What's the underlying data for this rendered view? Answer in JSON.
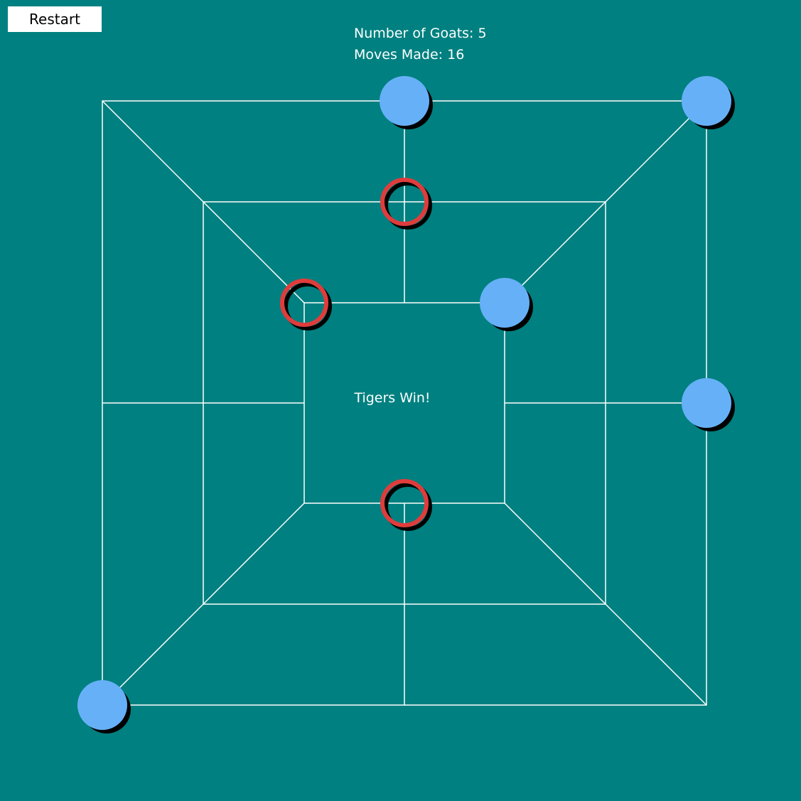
{
  "app": {
    "restart_label": "Restart",
    "goats_text": "Number of Goats: 5",
    "moves_text": "Moves Made: 16",
    "result_text": "Tigers Win!"
  },
  "colors": {
    "background": "#008080",
    "board_lines": "#ffffff",
    "goat": "#66b0f8",
    "tiger": "#e03c3c",
    "shadow": "#000000"
  },
  "board": {
    "rings": 3,
    "goats": [
      {
        "ring": "outer",
        "point": "top-middle"
      },
      {
        "ring": "outer",
        "point": "top-right"
      },
      {
        "ring": "outer",
        "point": "right-middle"
      },
      {
        "ring": "outer",
        "point": "bottom-left"
      },
      {
        "ring": "inner",
        "point": "top-right"
      }
    ],
    "tigers": [
      {
        "ring": "middle",
        "point": "top-middle"
      },
      {
        "ring": "inner",
        "point": "top-left"
      },
      {
        "ring": "inner",
        "point": "bottom-middle"
      }
    ]
  }
}
